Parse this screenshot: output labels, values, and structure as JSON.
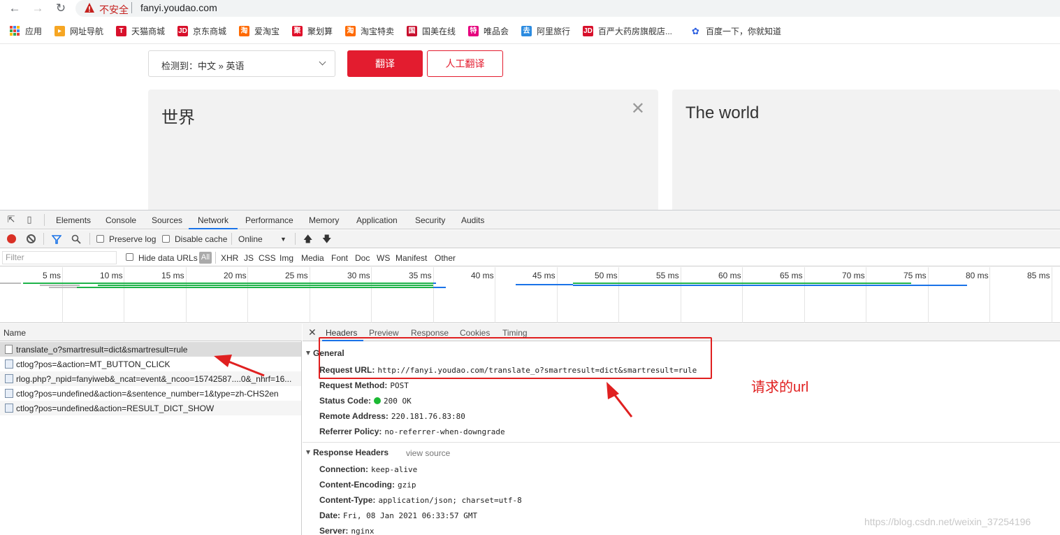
{
  "browser": {
    "security_label": "不安全",
    "url": "fanyi.youdao.com",
    "bookmarks": [
      {
        "label": "应用",
        "icon": "apps-grid-icon"
      },
      {
        "label": "网址导航",
        "icon": "navigation-icon",
        "color": "#f6a623"
      },
      {
        "label": "天猫商城",
        "icon": "tmall-icon",
        "color": "#d8102b"
      },
      {
        "label": "京东商城",
        "icon": "jd-icon",
        "color": "#d8102b"
      },
      {
        "label": "爱淘宝",
        "icon": "taobao-icon",
        "color": "#ff6a00"
      },
      {
        "label": "聚划算",
        "icon": "juhuasuan-icon",
        "color": "#e0102a"
      },
      {
        "label": "淘宝特卖",
        "icon": "taobao-sale-icon",
        "color": "#ff6a00"
      },
      {
        "label": "国美在线",
        "icon": "gome-icon",
        "color": "#c8102e"
      },
      {
        "label": "唯品会",
        "icon": "vip-icon",
        "color": "#e6007e"
      },
      {
        "label": "阿里旅行",
        "icon": "alitrip-icon",
        "color": "#2b8be0"
      },
      {
        "label": "百严大药房旗舰店...",
        "icon": "jd-store-icon",
        "color": "#d8102b"
      },
      {
        "label": "百度一下，你就知道",
        "icon": "baidu-icon",
        "color": "#2b5ee0"
      }
    ]
  },
  "page": {
    "language_select": "检测到：中文  »  英语",
    "translate_button": "翻译",
    "human_translate_button": "人工翻译",
    "source_text": "世界",
    "result_text": "The world",
    "accent_color": "#e31c2f"
  },
  "devtools": {
    "tabs": [
      "Elements",
      "Console",
      "Sources",
      "Network",
      "Performance",
      "Memory",
      "Application",
      "Security",
      "Audits"
    ],
    "active_tab": "Network",
    "toolbar": {
      "preserve_log": "Preserve log",
      "disable_cache": "Disable cache",
      "throttle": "Online"
    },
    "filter": {
      "placeholder": "Filter",
      "hide_data_urls": "Hide data URLs",
      "all": "All",
      "types": [
        "XHR",
        "JS",
        "CSS",
        "Img",
        "Media",
        "Font",
        "Doc",
        "WS",
        "Manifest",
        "Other"
      ]
    },
    "timeline_ticks": [
      "5 ms",
      "10 ms",
      "15 ms",
      "20 ms",
      "25 ms",
      "30 ms",
      "35 ms",
      "40 ms",
      "45 ms",
      "50 ms",
      "55 ms",
      "60 ms",
      "65 ms",
      "70 ms",
      "75 ms",
      "80 ms",
      "85 ms"
    ],
    "name_header": "Name",
    "requests": [
      "translate_o?smartresult=dict&smartresult=rule",
      "ctlog?pos=&action=MT_BUTTON_CLICK",
      "rlog.php?_npid=fanyiweb&_ncat=event&_ncoo=15742587....0&_nhrf=16...",
      "ctlog?pos=undefined&action=&sentence_number=1&type=zh-CHS2en",
      "ctlog?pos=undefined&action=RESULT_DICT_SHOW"
    ],
    "detail_tabs": [
      "Headers",
      "Preview",
      "Response",
      "Cookies",
      "Timing"
    ],
    "general": {
      "title": "General",
      "request_url_key": "Request URL:",
      "request_url": "http://fanyi.youdao.com/translate_o?smartresult=dict&smartresult=rule",
      "method_key": "Request Method:",
      "method": "POST",
      "status_key": "Status Code:",
      "status": "200 OK",
      "remote_key": "Remote Address:",
      "remote": "220.181.76.83:80",
      "referrer_key": "Referrer Policy:",
      "referrer": "no-referrer-when-downgrade"
    },
    "response_headers": {
      "title": "Response Headers",
      "view_source": "view source",
      "items": [
        {
          "key": "Connection:",
          "value": "keep-alive"
        },
        {
          "key": "Content-Encoding:",
          "value": "gzip"
        },
        {
          "key": "Content-Type:",
          "value": "application/json; charset=utf-8"
        },
        {
          "key": "Date:",
          "value": "Fri, 08 Jan 2021 06:33:57 GMT"
        },
        {
          "key": "Server:",
          "value": "nginx"
        }
      ]
    }
  },
  "annotation": {
    "label": "请求的url",
    "color": "#e02020"
  },
  "watermark": "https://blog.csdn.net/weixin_37254196"
}
